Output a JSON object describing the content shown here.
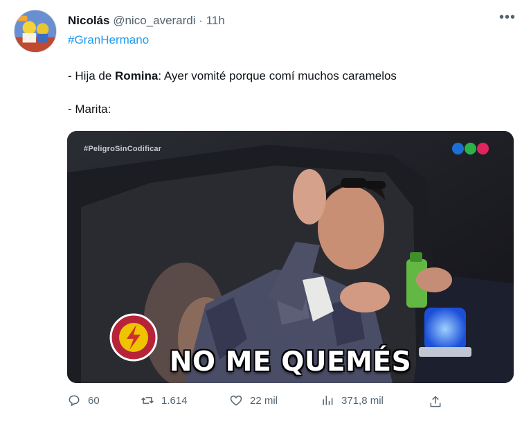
{
  "author": {
    "name": "Nicolás",
    "handle": "@nico_averardi",
    "separator": "·",
    "time": "11h"
  },
  "more_label": "•••",
  "tweet": {
    "hashtag": "#GranHermano",
    "line1_prefix": "- Hija de ",
    "line1_bold": "Romina",
    "line1_suffix": ": Ayer vomité porque comí muchos caramelos",
    "line2": "- Marita:"
  },
  "media": {
    "watermark": "#PeligroSinCodificar",
    "caption": "NO ME QUEMÉS",
    "logo_colors": [
      "#1d6fd6",
      "#2bb34a",
      "#e0245e"
    ]
  },
  "actions": {
    "replies": "60",
    "retweets": "1.614",
    "likes": "22 mil",
    "views": "371,8 mil"
  },
  "icons": [
    "reply-icon",
    "retweet-icon",
    "like-icon",
    "views-icon",
    "share-icon",
    "more-icon"
  ]
}
